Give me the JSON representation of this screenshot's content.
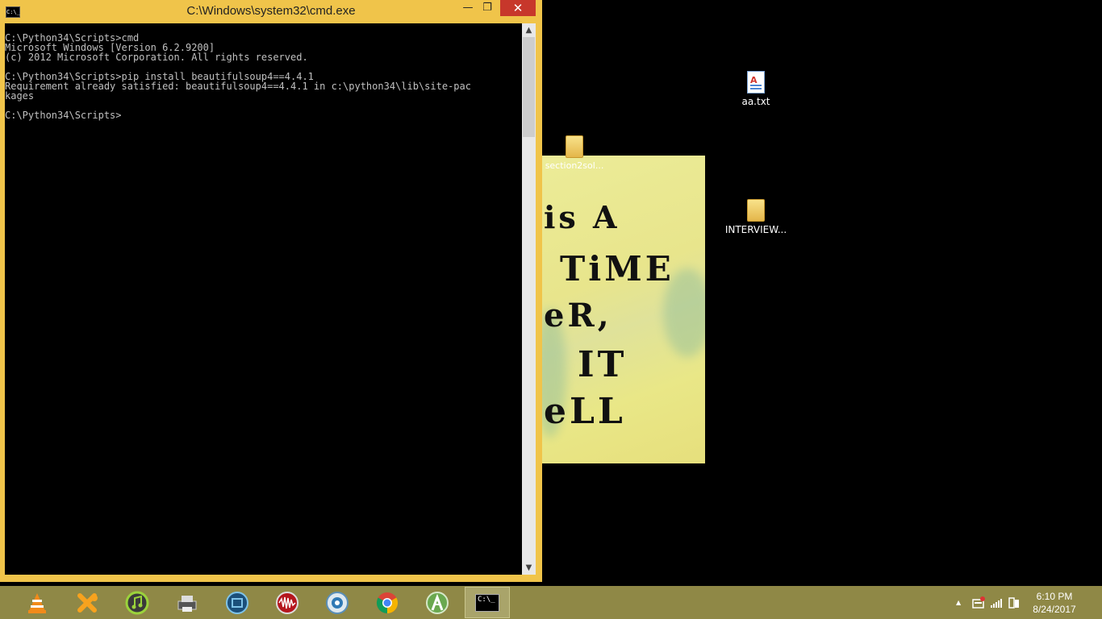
{
  "window": {
    "title": "C:\\Windows\\system32\\cmd.exe",
    "icon_label": "C:\\_",
    "controls": {
      "minimize": "—",
      "maximize": "❐",
      "close": "✕"
    }
  },
  "console": {
    "lines": [
      "C:\\Python34\\Scripts>cmd",
      "Microsoft Windows [Version 6.2.9200]",
      "(c) 2012 Microsoft Corporation. All rights reserved.",
      "",
      "C:\\Python34\\Scripts>pip install beautifulsoup4==4.4.1",
      "Requirement already satisfied: beautifulsoup4==4.4.1 in c:\\python34\\lib\\site-pac",
      "kages",
      "",
      "C:\\Python34\\Scripts>"
    ]
  },
  "desktop": {
    "icons": [
      {
        "label": "aa.txt",
        "icon": "text-file-icon"
      },
      {
        "label": "section2sol...",
        "icon": "folder-icon"
      },
      {
        "label": "INTERVIEW...",
        "icon": "folder-icon"
      }
    ],
    "wallpaper_text": [
      "is  A",
      "TiME",
      "eR,",
      "IT",
      "eLL"
    ]
  },
  "taskbar": {
    "apps": [
      {
        "name": "vlc-icon"
      },
      {
        "name": "xampp-icon"
      },
      {
        "name": "itunes-icon"
      },
      {
        "name": "printer-icon"
      },
      {
        "name": "video-editor-icon"
      },
      {
        "name": "audio-recorder-icon"
      },
      {
        "name": "media-player-icon"
      },
      {
        "name": "chrome-icon"
      },
      {
        "name": "android-studio-icon"
      },
      {
        "name": "cmd-icon",
        "label": "C:\\_",
        "active": true
      }
    ],
    "tray": {
      "chevron": "▲",
      "time": "6:10 PM",
      "date": "8/24/2017"
    }
  },
  "colors": {
    "window_frame": "#f0c44a",
    "close_button": "#c7372b",
    "console_bg": "#000000",
    "console_text": "#c0c0c0",
    "taskbar": "#8f8846"
  }
}
